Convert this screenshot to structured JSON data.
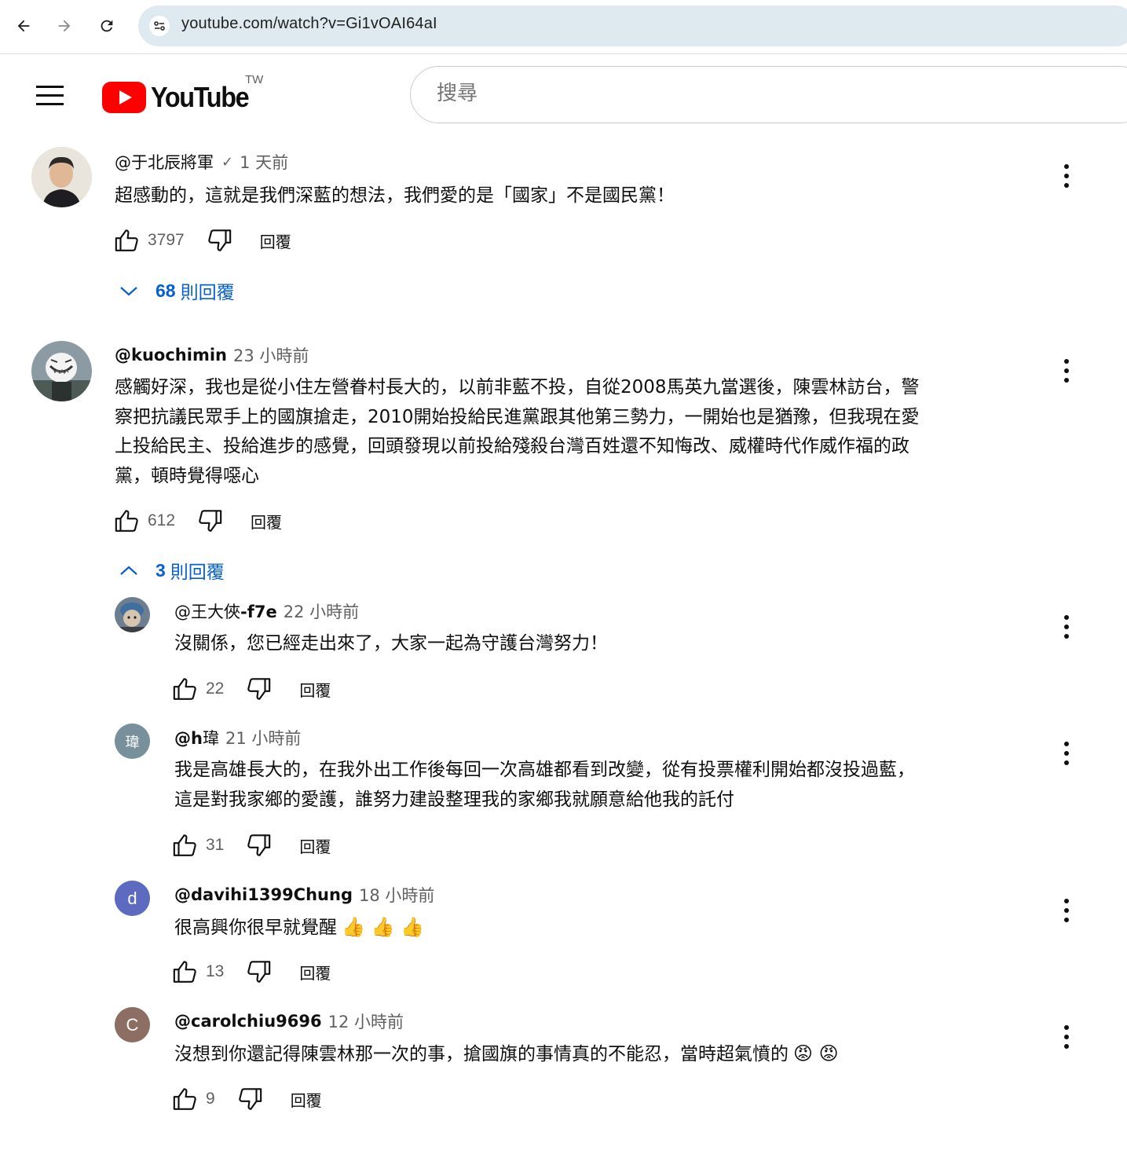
{
  "browser": {
    "url": "youtube.com/watch?v=Gi1vOAI64aI"
  },
  "header": {
    "logo_text": "YouTube",
    "region": "TW",
    "search_placeholder": "搜尋"
  },
  "labels": {
    "reply": "回覆"
  },
  "comments": [
    {
      "author": "@于北辰將軍",
      "verified": "✓",
      "time": "1 天前",
      "text": "超感動的，這就是我們深藍的想法，我們愛的是「國家」不是國民黨！",
      "likes": "3797",
      "replies_count": "68",
      "replies_label": "則回覆"
    },
    {
      "author": "@kuochimin",
      "time": "23 小時前",
      "text_lines": [
        "感觸好深，我也是從小住左營眷村長大的，以前非藍不投，自從2008馬英九當選後，陳雲林訪台，警",
        "察把抗議民眾手上的國旗搶走，2010開始投給民進黨跟其他第三勢力，一開始也是猶豫，但我現在愛",
        "上投給民主、投給進步的感覺，回頭發現以前投給殘殺台灣百姓還不知悔改、威權時代作威作福的政",
        "黨，頓時覺得噁心"
      ],
      "likes": "612",
      "replies_count": "3",
      "replies_label": "則回覆"
    }
  ],
  "replies": [
    {
      "author_prefix": "@王大俠",
      "author_suffix": "-f7e",
      "time": "22 小時前",
      "text": "沒關係，您已經走出來了，大家一起為守護台灣努力！",
      "likes": "22"
    },
    {
      "author_prefix": "@h",
      "author_suffix": "瑋",
      "avatar_letter": "瑋",
      "time": "21 小時前",
      "text_lines": [
        "我是高雄長大的，在我外出工作後每回一次高雄都看到改變，從有投票權利開始都沒投過藍，",
        "這是對我家鄉的愛護，誰努力建設整理我的家鄉我就願意給他我的託付"
      ],
      "likes": "31"
    },
    {
      "author": "@davihi1399Chung",
      "avatar_letter": "d",
      "time": "18 小時前",
      "text": "很高興你很早就覺醒",
      "emoji": "👍 👍 👍",
      "likes": "13"
    },
    {
      "author": "@carolchiu9696",
      "avatar_letter": "C",
      "time": "12 小時前",
      "text": "沒想到你還記得陳雲林那一次的事，搶國旗的事情真的不能忍，當時超氣憤的",
      "emoji": "😡 😡",
      "likes": "9"
    }
  ],
  "colors": {
    "link_blue": "#065fd4",
    "brand_red": "#ff0000",
    "avatar_h": "#78909c",
    "avatar_d": "#5c6bc0",
    "avatar_c": "#8d6e63"
  }
}
